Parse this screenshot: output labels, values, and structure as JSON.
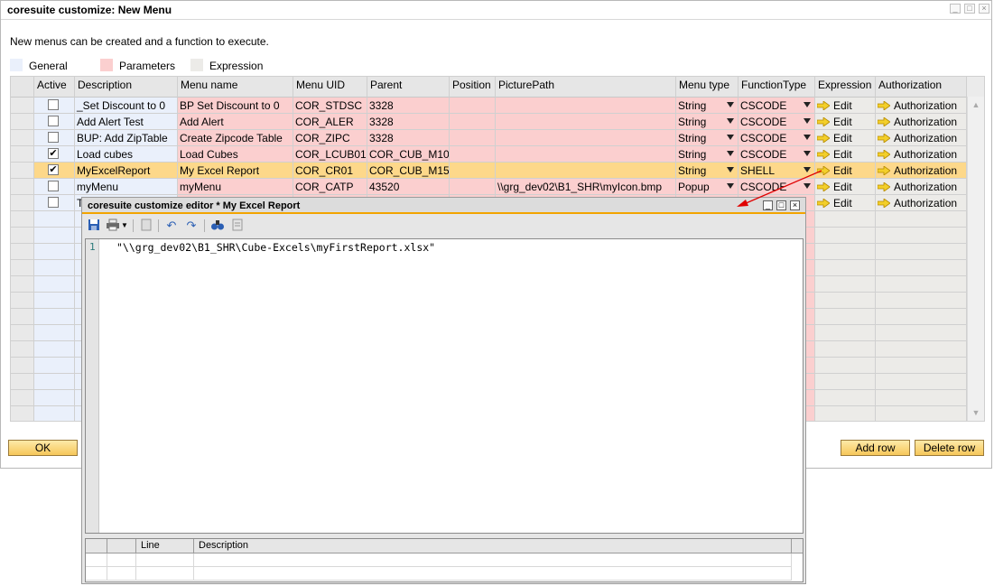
{
  "window": {
    "title": "coresuite customize: New Menu"
  },
  "intro": "New menus can be created and a function to execute.",
  "legend": [
    {
      "label": "General",
      "color": "#eaf0fb"
    },
    {
      "label": "Parameters",
      "color": "#fbcfcf"
    },
    {
      "label": "Expression",
      "color": "#ecebe8"
    }
  ],
  "columns": {
    "active": "Active",
    "description": "Description",
    "menu_name": "Menu name",
    "menu_uid": "Menu UID",
    "parent": "Parent",
    "position": "Position",
    "picture_path": "PicturePath",
    "menu_type": "Menu type",
    "function_type": "FunctionType",
    "expression": "Expression",
    "authorization": "Authorization"
  },
  "rows": [
    {
      "active": false,
      "description": "_Set Discount to 0",
      "menu_name": "BP Set Discount to 0",
      "menu_uid": "COR_STDSC",
      "parent": "3328",
      "position": "",
      "picture_path": "",
      "menu_type": "String",
      "function_type": "CSCODE",
      "expression": "Edit",
      "authorization": "Authorization"
    },
    {
      "active": false,
      "description": "Add Alert Test",
      "menu_name": "Add Alert",
      "menu_uid": "COR_ALER",
      "parent": "3328",
      "position": "",
      "picture_path": "",
      "menu_type": "String",
      "function_type": "CSCODE",
      "expression": "Edit",
      "authorization": "Authorization"
    },
    {
      "active": false,
      "description": "BUP: Add ZipTable",
      "menu_name": "Create Zipcode Table",
      "menu_uid": "COR_ZIPC",
      "parent": "3328",
      "position": "",
      "picture_path": "",
      "menu_type": "String",
      "function_type": "CSCODE",
      "expression": "Edit",
      "authorization": "Authorization"
    },
    {
      "active": true,
      "description": "Load cubes",
      "menu_name": "Load Cubes",
      "menu_uid": "COR_LCUB01",
      "parent": "COR_CUB_M10",
      "position": "",
      "picture_path": "",
      "menu_type": "String",
      "function_type": "CSCODE",
      "expression": "Edit",
      "authorization": "Authorization"
    },
    {
      "active": true,
      "description": "MyExcelReport",
      "menu_name": "My Excel Report",
      "menu_uid": "COR_CR01",
      "parent": "COR_CUB_M15",
      "position": "",
      "picture_path": "",
      "menu_type": "String",
      "function_type": "SHELL",
      "expression": "Edit",
      "authorization": "Authorization"
    },
    {
      "active": false,
      "description": "myMenu",
      "menu_name": "myMenu",
      "menu_uid": "COR_CATP",
      "parent": "43520",
      "position": "",
      "picture_path": "\\\\grg_dev02\\B1_SHR\\myIcon.bmp",
      "menu_type": "Popup",
      "function_type": "CSCODE",
      "expression": "Edit",
      "authorization": "Authorization"
    },
    {
      "active": false,
      "description": "T",
      "menu_name": "",
      "menu_uid": "",
      "parent": "",
      "position": "",
      "picture_path": "",
      "menu_type": "",
      "function_type": "",
      "expression": "Edit",
      "authorization": "Authorization"
    }
  ],
  "selected_row": 4,
  "buttons": {
    "ok": "OK",
    "add_row": "Add row",
    "delete_row": "Delete row"
  },
  "editor": {
    "title": "coresuite customize editor * My Excel Report",
    "toolbar": [
      "save-icon",
      "print-icon",
      "dropdown-icon",
      "copy-icon",
      "undo-icon",
      "redo-icon",
      "find-icon",
      "replace-icon"
    ],
    "line_number": "1",
    "code": "\"\\\\grg_dev02\\B1_SHR\\Cube-Excels\\myFirstReport.xlsx\"",
    "errors_columns": {
      "line": "Line",
      "description": "Description"
    }
  },
  "colors": {
    "general": "#eaf0fb",
    "parameters": "#fbcfcf",
    "expression": "#ecebe8",
    "selected": "#fdd88a",
    "accent": "#f2a400",
    "annotation_arrow": "#e00000"
  }
}
